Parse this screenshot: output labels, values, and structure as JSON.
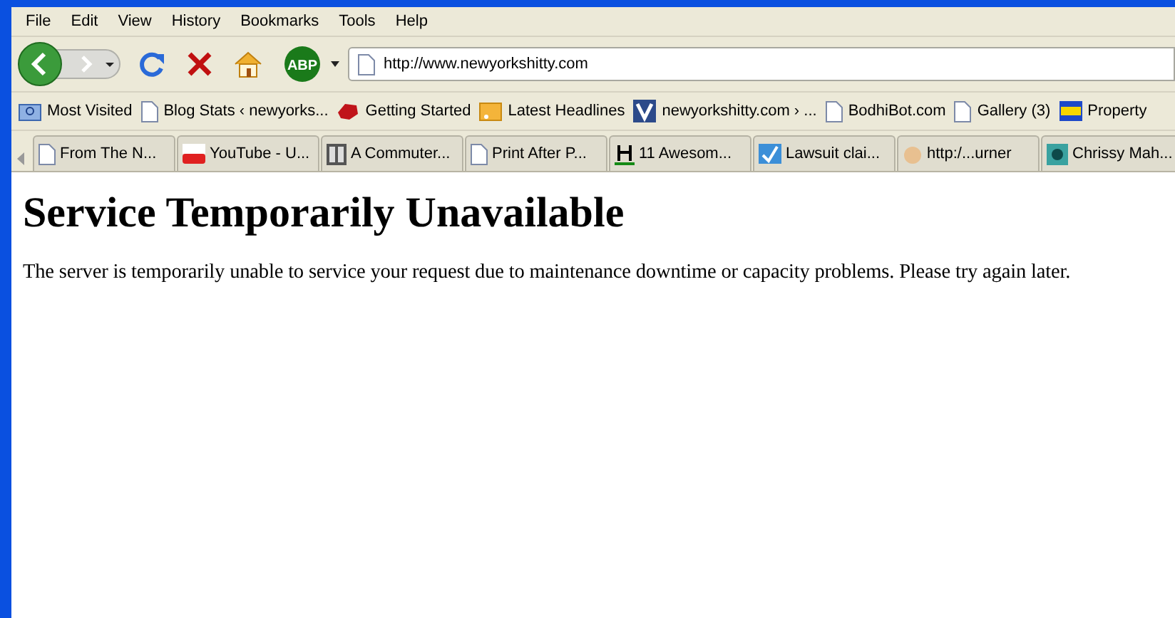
{
  "menu": [
    "File",
    "Edit",
    "View",
    "History",
    "Bookmarks",
    "Tools",
    "Help"
  ],
  "addon_button": "ABP",
  "address": {
    "value": "http://www.newyorkshitty.com"
  },
  "bookmarks": [
    {
      "label": "Most Visited",
      "kind": "folder"
    },
    {
      "label": "Blog Stats ‹ newyorks...",
      "kind": "page"
    },
    {
      "label": "Getting Started",
      "kind": "logo"
    },
    {
      "label": "Latest Headlines",
      "kind": "feed"
    },
    {
      "label": "newyorkshitty.com › ...",
      "kind": "letter"
    },
    {
      "label": "BodhiBot.com",
      "kind": "page"
    },
    {
      "label": "Gallery (3)",
      "kind": "page"
    },
    {
      "label": "Property",
      "kind": "badge"
    }
  ],
  "tabs": [
    {
      "label": "From The N...",
      "kind": "page",
      "selected": false
    },
    {
      "label": "YouTube - U...",
      "kind": "youtube",
      "selected": false
    },
    {
      "label": "A Commuter...",
      "kind": "mb",
      "selected": false
    },
    {
      "label": "Print After P...",
      "kind": "page",
      "selected": false
    },
    {
      "label": "11 Awesom...",
      "kind": "h",
      "selected": false
    },
    {
      "label": "Lawsuit clai...",
      "kind": "check",
      "selected": false
    },
    {
      "label": "http:/...urner",
      "kind": "face",
      "selected": false
    },
    {
      "label": "Chrissy Mah...",
      "kind": "pattern",
      "selected": false
    }
  ],
  "page": {
    "heading": "Service Temporarily Unavailable",
    "message": "The server is temporarily unable to service your request due to maintenance downtime or capacity problems. Please try again later."
  }
}
